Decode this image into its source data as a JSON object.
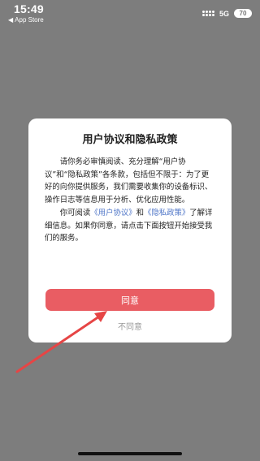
{
  "status_bar": {
    "time": "15:49",
    "back_app": "App Store",
    "network": "5G",
    "battery": "70"
  },
  "dialog": {
    "title": "用户协议和隐私政策",
    "paragraph1": "请你务必审慎阅读、充分理解“用户协议”和“隐私政策”各条款，包括但不限于：为了更好的向你提供服务，我们需要收集你的设备标识、操作日志等信息用于分析、优化应用性能。",
    "paragraph2": {
      "prefix": "你可阅读",
      "user_agreement_link": "《用户协议》",
      "middle": "和",
      "privacy_policy_link": "《隐私政策》",
      "suffix": "了解详细信息。如果你同意，请点击下面按钮开始接受我们的服务。"
    },
    "agree_label": "同意",
    "decline_label": "不同意"
  },
  "colors": {
    "overlay": "#7d7d7d",
    "primary": "#e95d63",
    "link": "#4d74c7",
    "annotation_arrow": "#e64545"
  },
  "icons": {
    "back": "back-arrow-icon",
    "signal": "signal-dots-icon",
    "battery": "battery-icon"
  }
}
